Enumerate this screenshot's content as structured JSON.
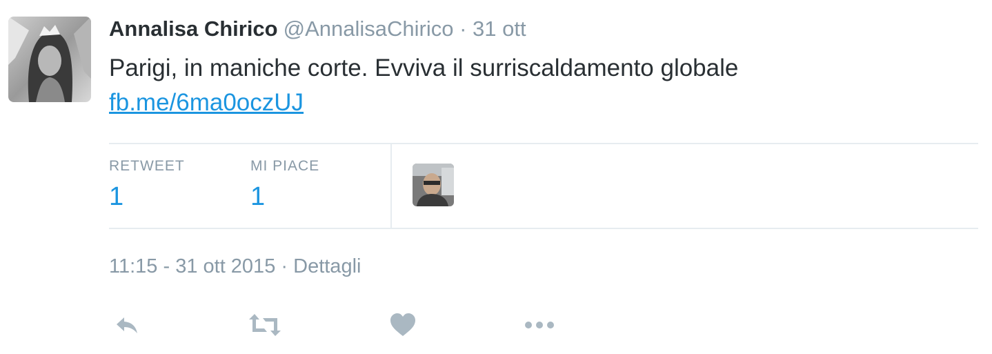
{
  "tweet": {
    "author_name": "Annalisa Chirico",
    "author_handle": "@AnnalisaChirico",
    "separator": "·",
    "date_short": "31 ott",
    "text": "Parigi, in maniche corte. Evviva il surriscaldamento globale ",
    "link_text": "fb.me/6ma0oczUJ",
    "stats": {
      "retweet_label": "RETWEET",
      "retweet_count": "1",
      "likes_label": "MI PIACE",
      "likes_count": "1"
    },
    "timestamp": "11:15 - 31 ott 2015",
    "details_label": "Dettagli",
    "actions": [
      "reply-icon",
      "retweet-icon",
      "heart-icon",
      "more-icon"
    ]
  },
  "colors": {
    "text": "#292f33",
    "muted": "#8899a6",
    "accent": "#1b95e0",
    "divider": "#e6ecf0",
    "icon": "#aab8c2"
  }
}
